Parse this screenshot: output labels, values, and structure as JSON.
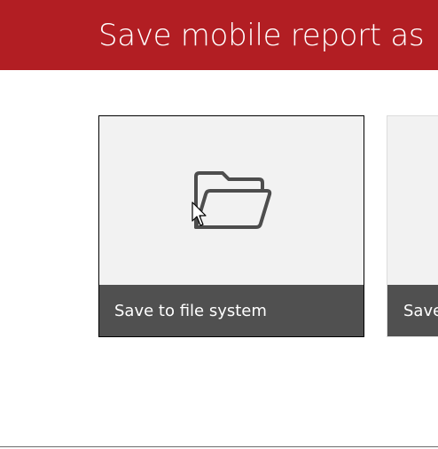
{
  "window": {
    "title": "Save mobile report as"
  },
  "options": [
    {
      "label": "Save to file system",
      "icon": "folder-open-icon"
    },
    {
      "label": "Save"
    }
  ],
  "colors": {
    "header": "#b21e23",
    "tile_background": "#f2f2f2",
    "label_bar": "#505050"
  }
}
